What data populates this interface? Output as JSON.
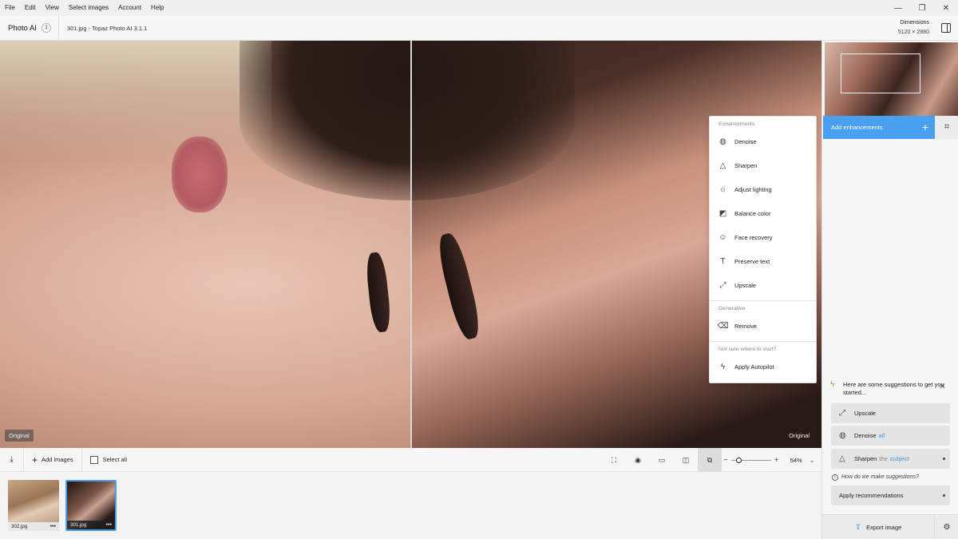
{
  "menu": [
    "File",
    "Edit",
    "View",
    "Select images",
    "Account",
    "Help"
  ],
  "window_controls": {
    "minimize": "—",
    "restore": "❐",
    "close": "✕"
  },
  "titlebar": {
    "app_name": "Photo AI",
    "badge": "3",
    "file_title": "301.jpg - Topaz Photo AI 3.1.1",
    "dimensions_label": "Dimensions",
    "dimensions_value": "5120 × 2880"
  },
  "canvas": {
    "left_label": "Original",
    "right_label": "Original"
  },
  "enhancements_menu": {
    "section_enhancements": "Enhancements",
    "items": [
      {
        "label": "Denoise",
        "icon": "globe-icon"
      },
      {
        "label": "Sharpen",
        "icon": "triangle-icon"
      },
      {
        "label": "Adjust lighting",
        "icon": "sun-icon"
      },
      {
        "label": "Balance color",
        "icon": "color-square-icon"
      },
      {
        "label": "Face recovery",
        "icon": "smiley-icon"
      },
      {
        "label": "Preserve text",
        "icon": "text-t-icon"
      },
      {
        "label": "Upscale",
        "icon": "diagonal-arrows-icon"
      }
    ],
    "section_generative": "Generative",
    "remove_label": "Remove",
    "section_help": "Not sure where to start?",
    "autopilot_label": "Apply Autopilot"
  },
  "right_panel": {
    "add_enhancements": "Add enhancements",
    "suggestions_title": "Here are some suggestions to get you started...",
    "suggestions": [
      {
        "label": "Upscale",
        "qualifier": "",
        "target": ""
      },
      {
        "label": "Denoise",
        "qualifier": "",
        "target": "all"
      },
      {
        "label": "Sharpen",
        "qualifier": "the",
        "target": "subject"
      }
    ],
    "how_label": "How do we make suggestions?",
    "apply_recommendations": "Apply recommendations",
    "export_label": "Export image"
  },
  "bottom_bar": {
    "add_images": "Add images",
    "select_all": "Select all",
    "zoom_value": "54%"
  },
  "zoom_level": 0.54,
  "filmstrip": [
    {
      "name": "302.jpg",
      "more": "•••",
      "selected": false
    },
    {
      "name": "301.jpg",
      "more": "•••",
      "selected": true
    }
  ],
  "colors": {
    "accent": "#4aa0f0",
    "suggest_icon": "#6bb33a"
  }
}
